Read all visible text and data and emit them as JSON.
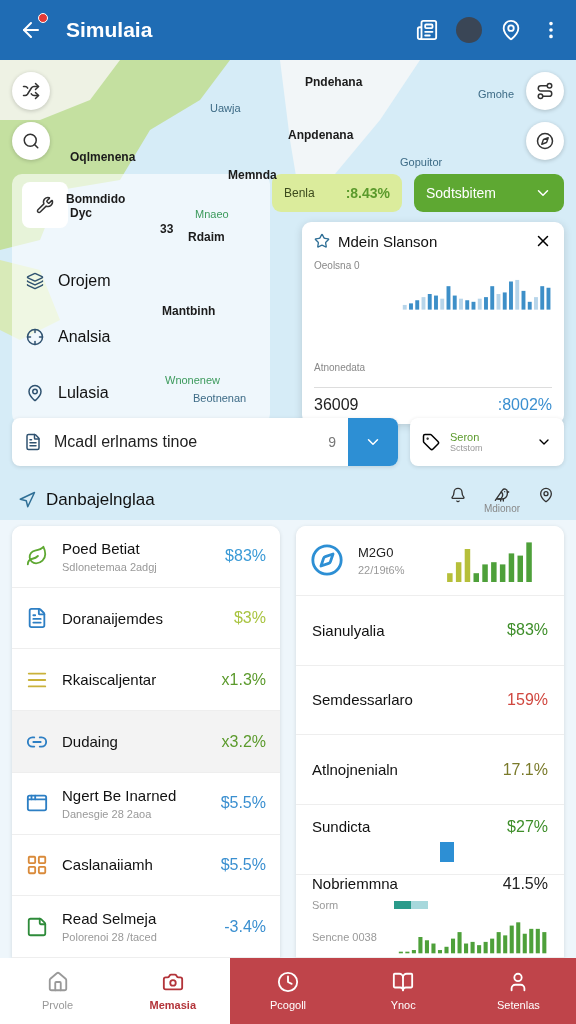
{
  "app_bar": {
    "title": "Simulaia",
    "back_badge": true
  },
  "map_labels": [
    {
      "text": "Pndehana",
      "kind": "city"
    },
    {
      "text": "Uawja",
      "kind": "region"
    },
    {
      "text": "Gmohe",
      "kind": "region"
    },
    {
      "text": "Anpdenana",
      "kind": "city"
    },
    {
      "text": "Oqlmenena",
      "kind": "city"
    },
    {
      "text": "Gopuitor",
      "kind": "region"
    },
    {
      "text": "Memnda",
      "kind": "city"
    },
    {
      "text": "Bomndido",
      "kind": "city"
    },
    {
      "text": "Dyc",
      "kind": "city"
    },
    {
      "text": "33",
      "kind": "city"
    },
    {
      "text": "Mnaeo",
      "kind": "green"
    },
    {
      "text": "Rdaim",
      "kind": "city"
    },
    {
      "text": "Mantbinh",
      "kind": "city"
    },
    {
      "text": "Wnonenew",
      "kind": "green"
    },
    {
      "text": "Beotnenan",
      "kind": "region"
    }
  ],
  "layers": [
    {
      "label": "Orojem",
      "kind": "layers"
    },
    {
      "label": "Analsia",
      "kind": "target"
    },
    {
      "label": "Lulasia",
      "kind": "pin"
    }
  ],
  "stat_chip": {
    "label": "Benla",
    "value": ":8.43%"
  },
  "scenario_dropdown": {
    "label": "Sodtsbitem"
  },
  "popup": {
    "title": "Mdein Slanson",
    "caption": "Oeolsna 0",
    "axis_label": "Atnonedata",
    "total": "36009",
    "change": ":8002%"
  },
  "model_field": {
    "value": "Mcadl erlnams tinoe",
    "count": "9"
  },
  "season_select": {
    "label": "Seron",
    "sublabel": "Sctstom"
  },
  "section": {
    "title": "Danbajelnglaa",
    "caption": "Mdionor"
  },
  "left_list": [
    {
      "title": "Poed Betiat",
      "subtitle": "Sdlonetemaa 2adgj",
      "value": "$83%",
      "color": "#3a9ad6",
      "kind": "leaf",
      "selected": false
    },
    {
      "title": "Doranaijemdes",
      "value": "$3%",
      "color": "#a9c441",
      "kind": "doc",
      "selected": false
    },
    {
      "title": "Rkaiscaljentar",
      "value": "x1.3%",
      "color": "#5b9a2c",
      "kind": "lines",
      "selected": false
    },
    {
      "title": "Dudaing",
      "value": "x3.2%",
      "color": "#5b9a2c",
      "kind": "link",
      "selected": true
    },
    {
      "title": "Ngert Be Inarned",
      "subtitle": "Danesgie 28 2aoa",
      "value": "$5.5%",
      "color": "#3a8fd0",
      "kind": "window",
      "selected": false
    },
    {
      "title": "Caslanaiiamh",
      "value": "$5.5%",
      "color": "#3a8fd0",
      "kind": "grid",
      "selected": false
    },
    {
      "title": "Read Selmeja",
      "subtitle": "Polorenoi 28 /taced",
      "value": "-3.4%",
      "color": "#3a8fd0",
      "kind": "note",
      "selected": false
    }
  ],
  "right_summary": {
    "title": "M2G0",
    "subtitle": "22/19t6%"
  },
  "right_list": [
    {
      "title": "Sianulyalia",
      "value": "$83%",
      "color": "#3e8e2a",
      "kind": "plain"
    },
    {
      "title": "Semdessarlaro",
      "value": "159%",
      "color": "#d0473f",
      "kind": "plain"
    },
    {
      "title": "Atlnojnenialn",
      "value": "17.1%",
      "color": "#7a7a2a",
      "kind": "plain"
    },
    {
      "title": "Sundicta",
      "value": "$27%",
      "color": "#3e8e2a",
      "kind": "marker"
    },
    {
      "title": "Nobriemmna",
      "value": "41.5%",
      "color": "#222222",
      "kind": "spark",
      "note": "Sorm",
      "footer": "Sencne 0038"
    }
  ],
  "bottom_nav": [
    {
      "label": "Prvole",
      "kind": "plain",
      "selected": false
    },
    {
      "label": "Memasia",
      "kind": "plain",
      "selected": true
    },
    {
      "label": "Pcogoll",
      "kind": "accent",
      "selected": false
    },
    {
      "label": "Ynoc",
      "kind": "accent",
      "selected": false
    },
    {
      "label": "Setenlas",
      "kind": "accent",
      "selected": false
    }
  ]
}
